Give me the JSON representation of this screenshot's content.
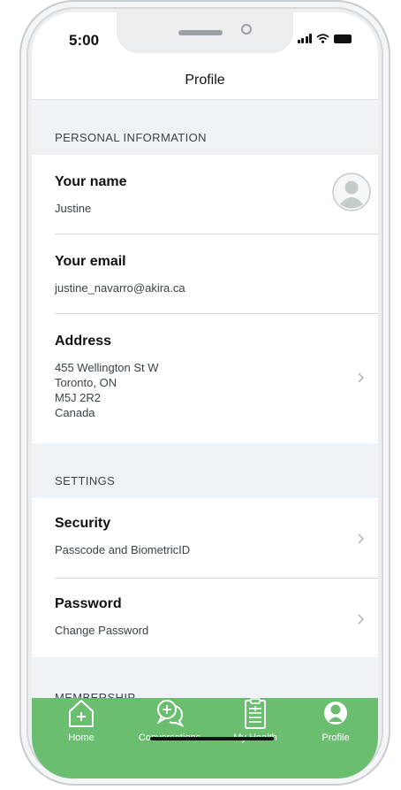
{
  "status_bar": {
    "time": "5:00"
  },
  "nav": {
    "title": "Profile"
  },
  "sections": {
    "personal": "PERSONAL INFORMATION",
    "settings": "SETTINGS",
    "membership": "MEMBERSHIP"
  },
  "rows": {
    "name_title": "Your name",
    "name_value": "Justine",
    "email_title": "Your email",
    "email_value": "justine_navarro@akira.ca",
    "address_title": "Address",
    "address_line1": "455 Wellington St W",
    "address_line2": "Toronto, ON",
    "address_line3": "M5J 2R2",
    "address_line4": "Canada",
    "security_title": "Security",
    "security_sub": "Passcode and BiometricID",
    "password_title": "Password",
    "password_sub": "Change Password"
  },
  "tabs": [
    {
      "label": "Home",
      "icon": "home-plus-icon"
    },
    {
      "label": "Conversations",
      "icon": "chat-bubbles-icon"
    },
    {
      "label": "My Health",
      "icon": "clipboard-icon"
    },
    {
      "label": "Profile",
      "icon": "person-icon"
    }
  ],
  "colors": {
    "tab_bar": "#6bbe70",
    "background": "#eff3f6"
  }
}
